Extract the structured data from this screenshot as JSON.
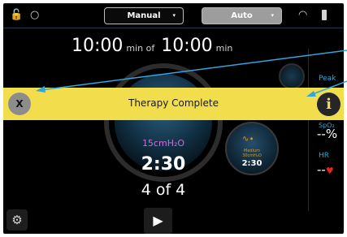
{
  "topbar": {
    "lock_icon": "unlock-icon",
    "user_icon": "user-icon",
    "manual_label": "Manual",
    "auto_label": "Auto",
    "wifi_icon": "wifi-icon",
    "battery_icon": "battery-icon"
  },
  "timer": {
    "elapsed": "10:00",
    "elapsed_unit": "min of",
    "total": "10:00",
    "total_unit": "min"
  },
  "main_dial": {
    "pressure": "15cmH₂O",
    "countdown": "2:30",
    "step": "4 of 4"
  },
  "mini_dial": {
    "label_top": "Medium",
    "label_bottom": "30cmH₂O",
    "time": "2:30"
  },
  "sidebar": {
    "peak_label": "Peak",
    "spo2_label": "SpO₂",
    "spo2_value": "--%",
    "hr_label": "HR",
    "hr_value": "--"
  },
  "banner": {
    "message": "Therapy Complete",
    "close_label": "X",
    "info_label": "i"
  },
  "colors": {
    "banner": "#f2dd4d",
    "accent": "#2ea6e0",
    "pressure": "#c86fd6",
    "heart": "#e02525"
  }
}
